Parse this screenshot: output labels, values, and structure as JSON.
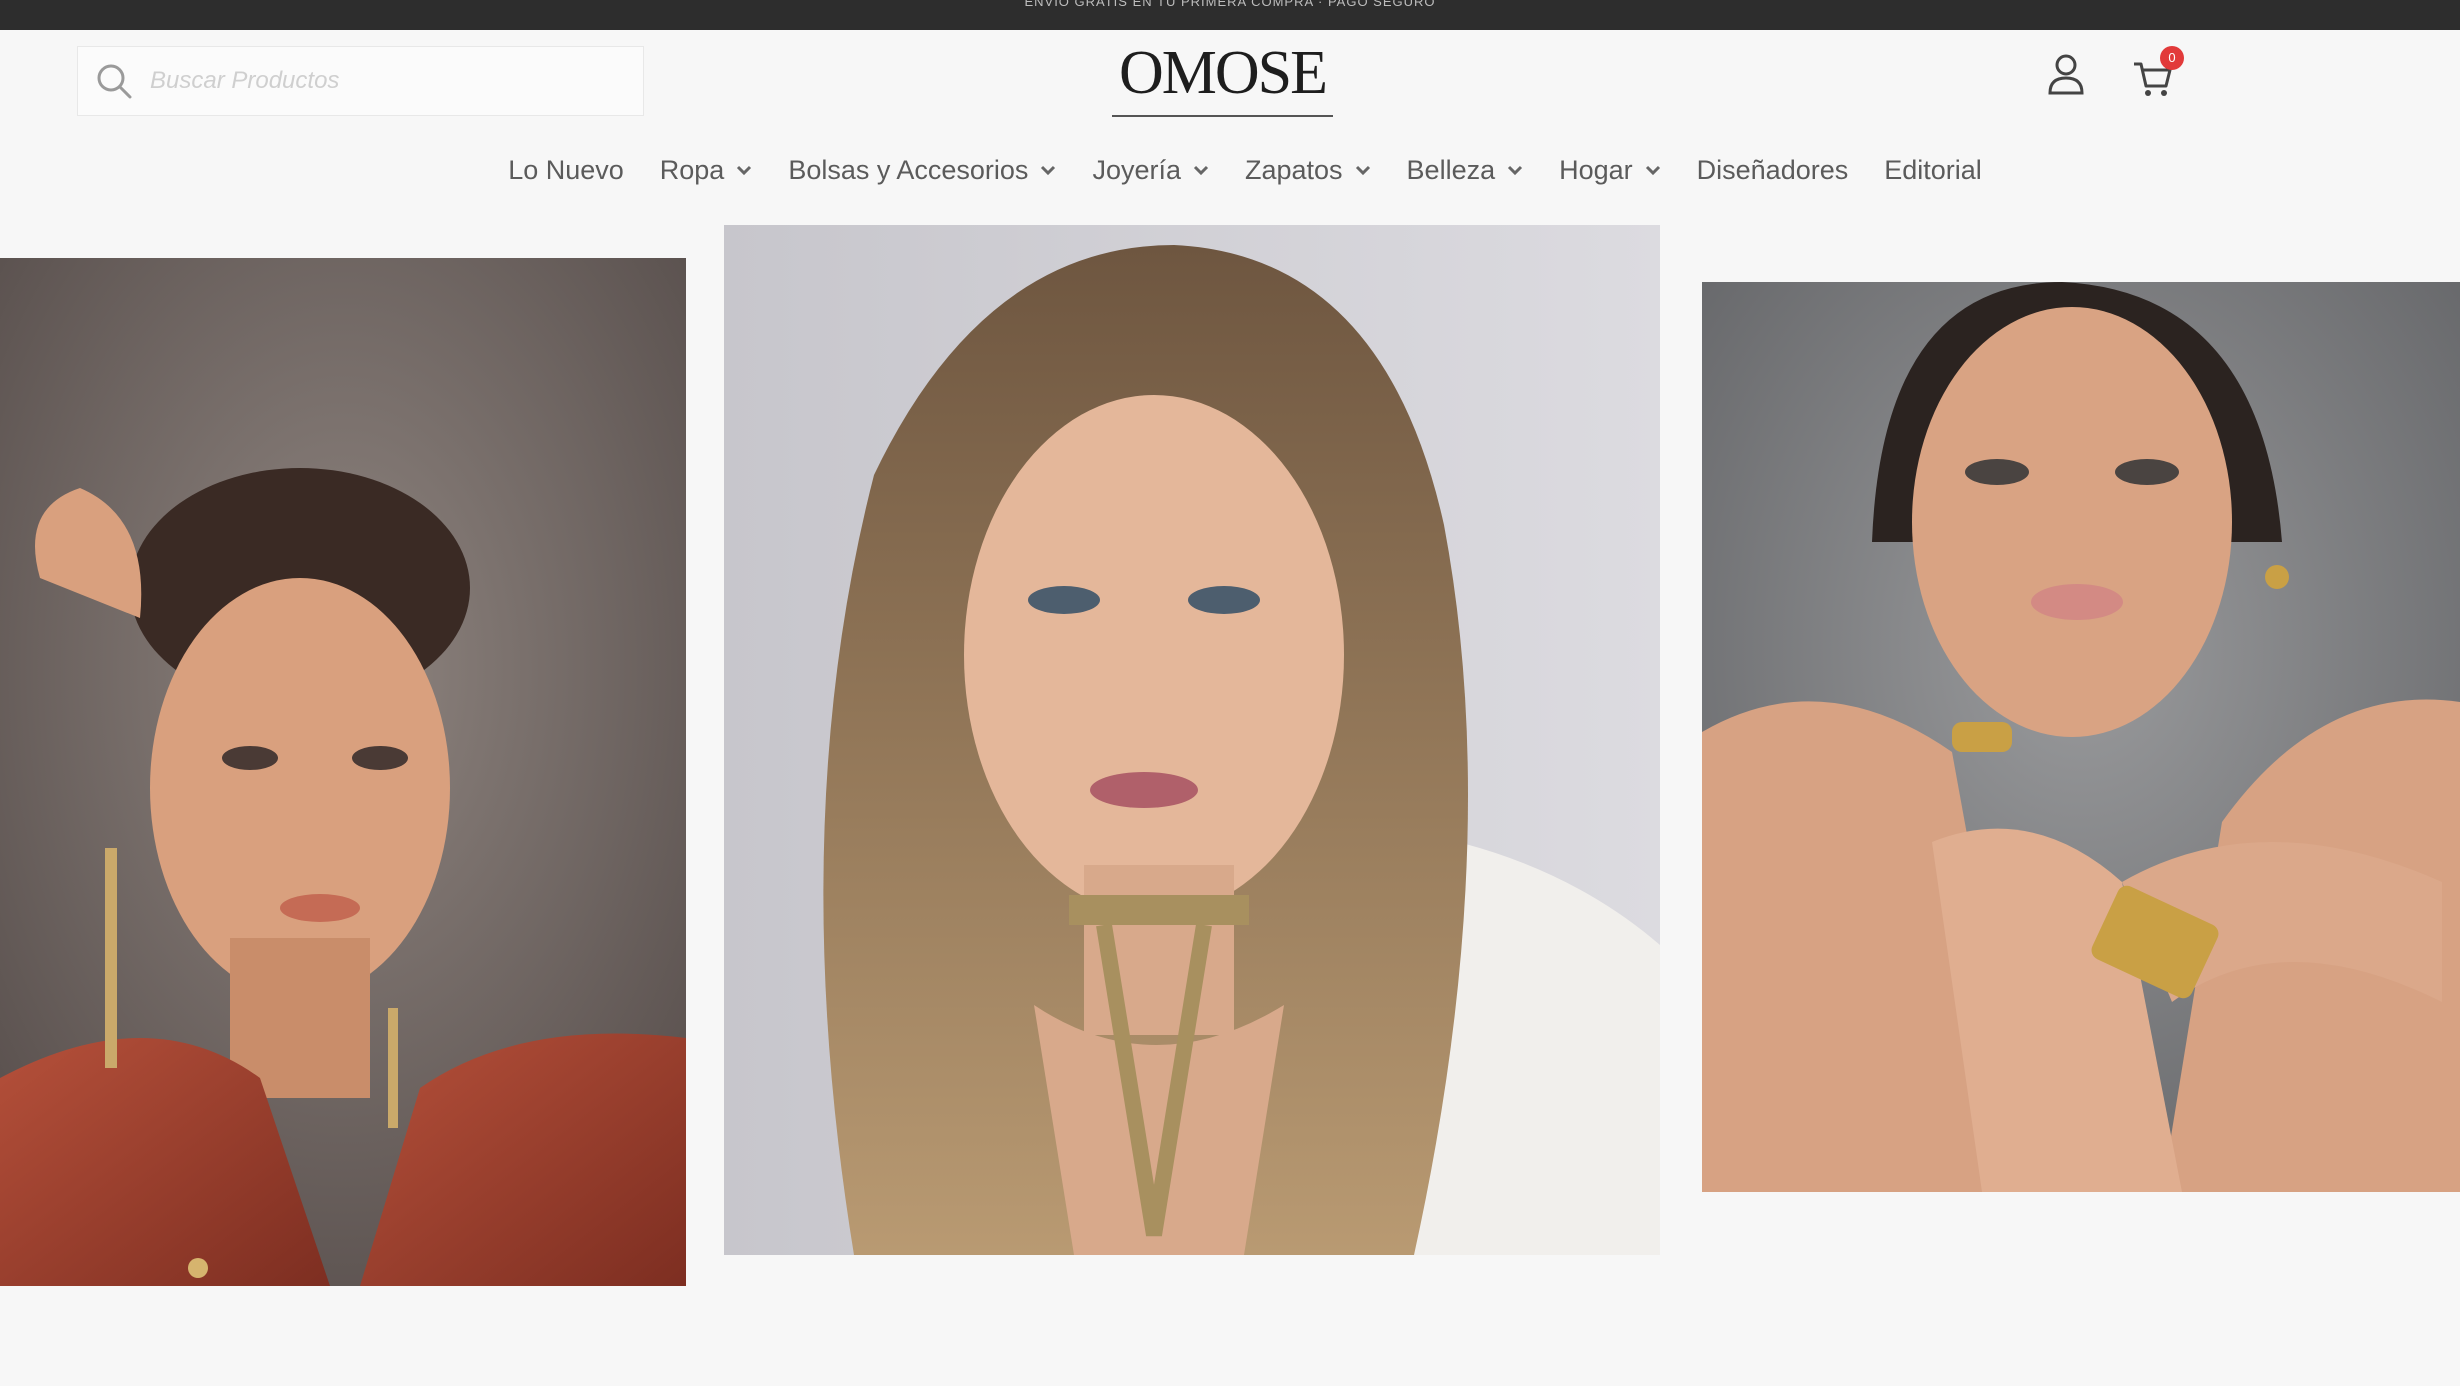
{
  "top_bar": {
    "promo_text": "ENVÍO GRATIS EN TU PRIMERA COMPRA · PAGO SEGURO"
  },
  "header": {
    "search": {
      "placeholder": "Buscar Productos"
    },
    "logo_text": "OMOSE",
    "cart_count": "0"
  },
  "nav": {
    "items": [
      {
        "label": "Lo Nuevo",
        "has_dropdown": false
      },
      {
        "label": "Ropa",
        "has_dropdown": true
      },
      {
        "label": "Bolsas y Accesorios",
        "has_dropdown": true
      },
      {
        "label": "Joyería",
        "has_dropdown": true
      },
      {
        "label": "Zapatos",
        "has_dropdown": true
      },
      {
        "label": "Belleza",
        "has_dropdown": true
      },
      {
        "label": "Hogar",
        "has_dropdown": true
      },
      {
        "label": "Diseñadores",
        "has_dropdown": false
      },
      {
        "label": "Editorial",
        "has_dropdown": false
      }
    ]
  },
  "colors": {
    "background": "#f7f7f7",
    "top_strip": "#2d2d2d",
    "nav_text": "#5b5b5b",
    "badge": "#e23a3a"
  },
  "icons": [
    "search-icon",
    "account-icon",
    "cart-icon",
    "chevron-down-icon"
  ]
}
